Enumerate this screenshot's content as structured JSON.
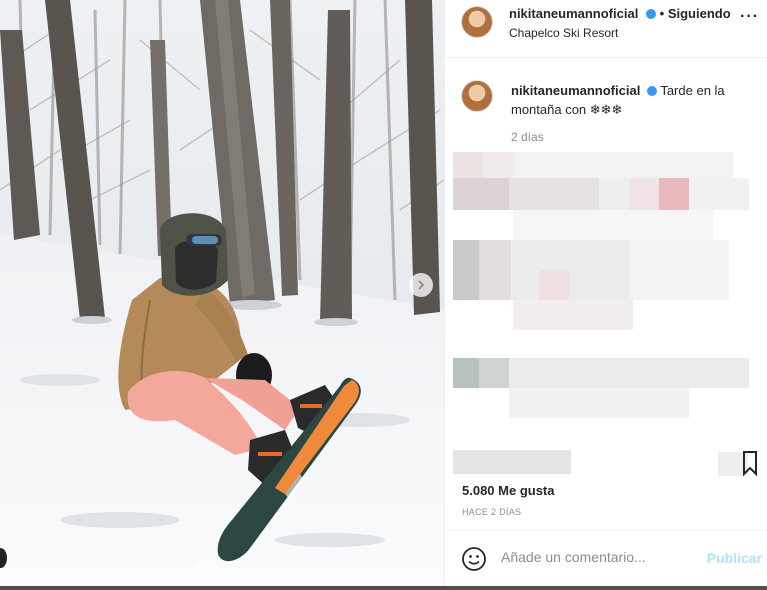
{
  "post": {
    "username": "nikitaneumannoficial",
    "follow_sep": "•",
    "follow_label": "Siguiendo",
    "location": "Chapelco Ski Resort",
    "caption_text": "Tarde en la montaña con ❄❄❄",
    "caption_time": "2 días",
    "likes_text": "5.080 Me gusta",
    "time_ago": "HACE 2 DÍAS",
    "comment_placeholder": "Añade un comentario...",
    "publish_label": "Publicar",
    "more_label": "···",
    "carousel": {
      "count": 3,
      "active": 0
    }
  },
  "colors": {
    "verified": "#3897f0",
    "publish_disabled": "#b2dffc"
  },
  "icons": [
    "verified-badge-icon",
    "more-options-icon",
    "carousel-next-icon",
    "bookmark-icon",
    "emoji-icon"
  ]
}
